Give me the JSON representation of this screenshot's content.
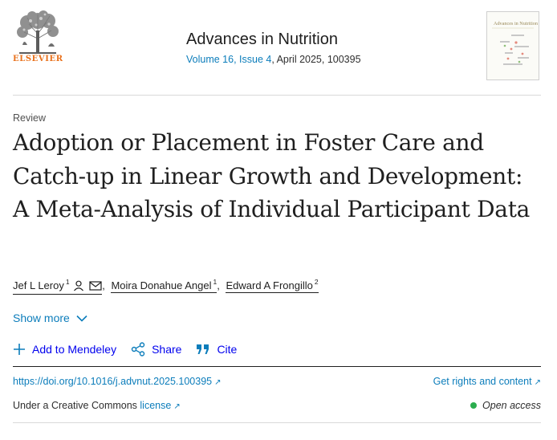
{
  "header": {
    "publisher": "ELSEVIER",
    "journal_title": "Advances in Nutrition",
    "issue_link": "Volume 16, Issue 4",
    "issue_rest": ", April 2025, 100395",
    "cover_title": "Advances in Nutrition"
  },
  "article": {
    "type": "Review",
    "title": "Adoption or Placement in Foster Care and Catch-up in Linear Growth and Development: A Meta-Analysis of Individual Participant Data"
  },
  "authors": [
    {
      "name": "Jef L Leroy",
      "affil": "1"
    },
    {
      "name": "Moira Donahue Angel",
      "affil": "1"
    },
    {
      "name": "Edward A Frongillo",
      "affil": "2"
    }
  ],
  "show_more": "Show more",
  "actions": {
    "mendeley": "Add to Mendeley",
    "share": "Share",
    "cite": "Cite"
  },
  "doi": "https://doi.org/10.1016/j.advnut.2025.100395",
  "rights": "Get rights and content",
  "license": {
    "prefix": "Under a Creative Commons",
    "link": "license"
  },
  "open_access": "Open access",
  "colors": {
    "link": "#0c7dbb",
    "publisher": "#e9711c",
    "open_access_dot": "#2bad4e"
  },
  "icons": [
    "elsevier-tree-logo",
    "person-icon",
    "mail-icon",
    "chevron-down-icon",
    "plus-icon",
    "share-icon",
    "quote-icon",
    "external-link-icon"
  ]
}
